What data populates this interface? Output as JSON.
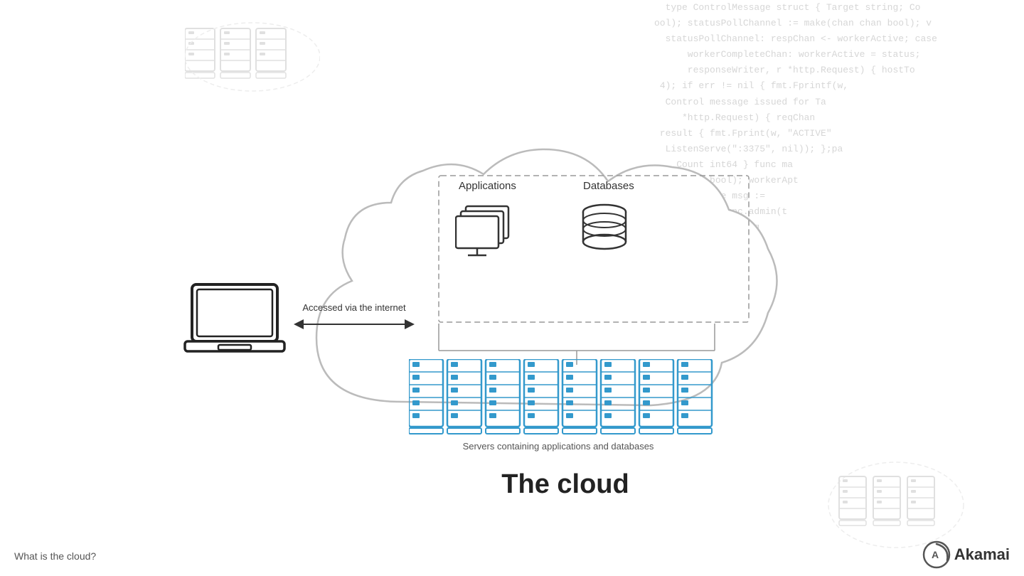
{
  "page": {
    "title": "What is the cloud?",
    "cloud_label": "The cloud",
    "arrow_label": "Accessed via the internet",
    "servers_label": "Servers containing applications and databases",
    "applications_label": "Applications",
    "databases_label": "Databases",
    "bottom_label": "What is the cloud?",
    "akamai_brand": "Akamai",
    "code_bg_text": "  type ControlMessage struct { Target string; Co\nool); statusPollChannel := make(chan chan bool); v\n  statusPollChannel: respChan <- workerActive; case\n      workerCompleteChan: workerActive = status;\n      responseWriter, r *http.Request) { hostTo\n 4); if err != nil { fmt.Fprintf(w,\n  Control message issued for Ta\n     *http.Request) { reqChan\n result { fmt.Fprint(w, \"ACTIVE\"\n  ListenServe(\":3375\", nil)); };pa\n    Count int64 } func ma\n     that bool); workerApt\n  active.case msg :=\n       blar.func.admin(t\n        startToRang\n      printf(w,"
  }
}
